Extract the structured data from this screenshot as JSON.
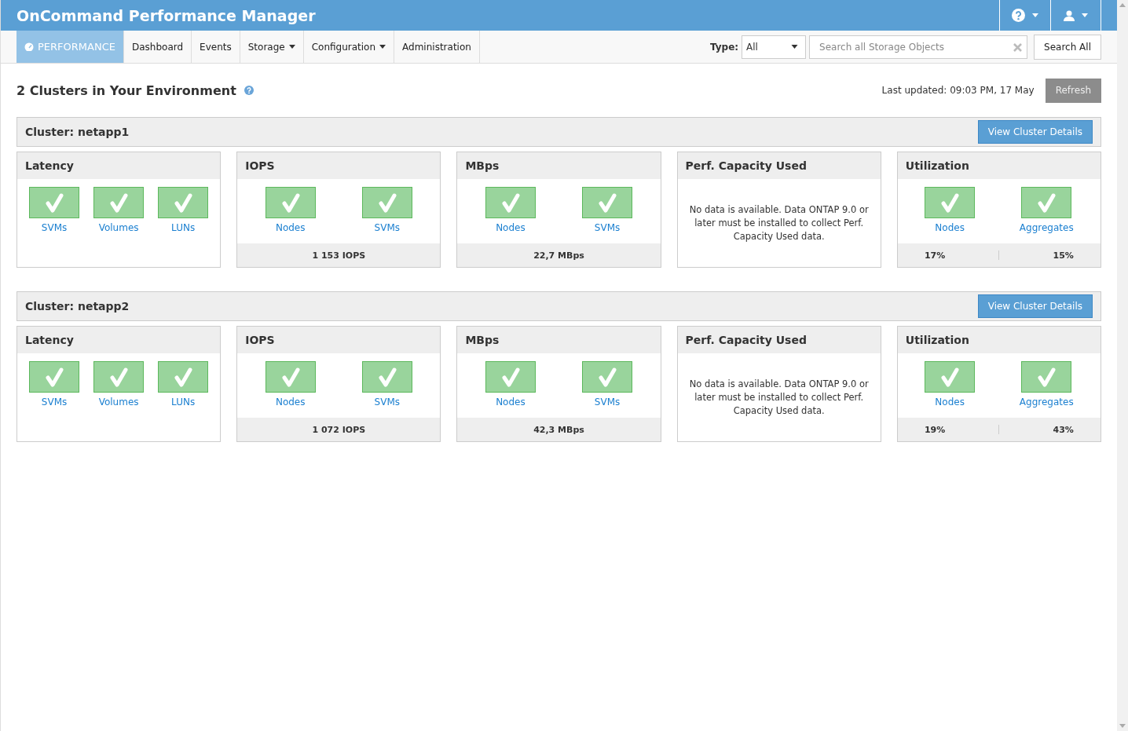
{
  "app_title": "OnCommand Performance Manager",
  "nav": {
    "tabs": [
      {
        "label": "PERFORMANCE",
        "selected": true,
        "has_menu": false
      },
      {
        "label": "Dashboard",
        "selected": false,
        "has_menu": false
      },
      {
        "label": "Events",
        "selected": false,
        "has_menu": false
      },
      {
        "label": "Storage",
        "selected": false,
        "has_menu": true
      },
      {
        "label": "Configuration",
        "selected": false,
        "has_menu": true
      },
      {
        "label": "Administration",
        "selected": false,
        "has_menu": false
      }
    ],
    "type_label": "Type:",
    "type_value": "All",
    "search_placeholder": "Search all Storage Objects",
    "search_button": "Search All"
  },
  "heading": "2 Clusters in Your Environment",
  "last_updated": "Last updated: 09:03 PM, 17 May",
  "refresh_button": "Refresh",
  "clusters": [
    {
      "title": "Cluster: netapp1",
      "details_button": "View Cluster Details",
      "panels": [
        {
          "kind": "status",
          "title": "Latency",
          "items": [
            {
              "label": "SVMs",
              "ok": true
            },
            {
              "label": "Volumes",
              "ok": true
            },
            {
              "label": "LUNs",
              "ok": true
            }
          ]
        },
        {
          "kind": "status",
          "title": "IOPS",
          "items": [
            {
              "label": "Nodes",
              "ok": true
            },
            {
              "label": "SVMs",
              "ok": true
            }
          ],
          "footer": [
            "1 153 IOPS"
          ]
        },
        {
          "kind": "status",
          "title": "MBps",
          "items": [
            {
              "label": "Nodes",
              "ok": true
            },
            {
              "label": "SVMs",
              "ok": true
            }
          ],
          "footer": [
            "22,7 MBps"
          ]
        },
        {
          "kind": "message",
          "title": "Perf. Capacity Used",
          "message": "No data is available. Data ONTAP 9.0 or later must be installed to collect Perf. Capacity Used data."
        },
        {
          "kind": "status",
          "title": "Utilization",
          "items": [
            {
              "label": "Nodes",
              "ok": true
            },
            {
              "label": "Aggregates",
              "ok": true
            }
          ],
          "footer": [
            "17%",
            "15%"
          ]
        }
      ]
    },
    {
      "title": "Cluster: netapp2",
      "details_button": "View Cluster Details",
      "panels": [
        {
          "kind": "status",
          "title": "Latency",
          "items": [
            {
              "label": "SVMs",
              "ok": true
            },
            {
              "label": "Volumes",
              "ok": true
            },
            {
              "label": "LUNs",
              "ok": true
            }
          ]
        },
        {
          "kind": "status",
          "title": "IOPS",
          "items": [
            {
              "label": "Nodes",
              "ok": true
            },
            {
              "label": "SVMs",
              "ok": true
            }
          ],
          "footer": [
            "1 072 IOPS"
          ]
        },
        {
          "kind": "status",
          "title": "MBps",
          "items": [
            {
              "label": "Nodes",
              "ok": true
            },
            {
              "label": "SVMs",
              "ok": true
            }
          ],
          "footer": [
            "42,3 MBps"
          ]
        },
        {
          "kind": "message",
          "title": "Perf. Capacity Used",
          "message": "No data is available. Data ONTAP 9.0 or later must be installed to collect Perf. Capacity Used data."
        },
        {
          "kind": "status",
          "title": "Utilization",
          "items": [
            {
              "label": "Nodes",
              "ok": true
            },
            {
              "label": "Aggregates",
              "ok": true
            }
          ],
          "footer": [
            "19%",
            "43%"
          ]
        }
      ]
    }
  ]
}
